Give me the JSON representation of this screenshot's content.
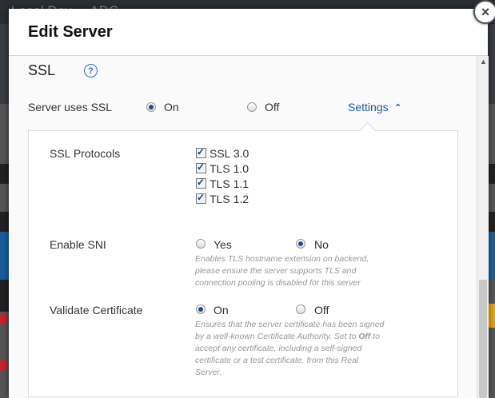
{
  "background": {
    "title": "Local Dev ... ADC"
  },
  "dialog": {
    "title": "Edit Server",
    "close_label": "×"
  },
  "ssl": {
    "section_title": "SSL",
    "help_label": "?",
    "server_uses_ssl": {
      "label": "Server uses SSL",
      "options": [
        {
          "label": "On",
          "checked": true
        },
        {
          "label": "Off",
          "checked": false
        }
      ]
    },
    "settings_link": "Settings",
    "settings_chevron": "⌃",
    "protocols": {
      "label": "SSL Protocols",
      "items": [
        {
          "label": "SSL 3.0",
          "checked": true
        },
        {
          "label": "TLS 1.0",
          "checked": true
        },
        {
          "label": "TLS 1.1",
          "checked": true
        },
        {
          "label": "TLS 1.2",
          "checked": true
        }
      ]
    },
    "sni": {
      "label": "Enable SNI",
      "options": [
        {
          "label": "Yes",
          "checked": false
        },
        {
          "label": "No",
          "checked": true
        }
      ],
      "help": [
        "Enables TLS hostname extension on backend,",
        "please ensure the server supports TLS and",
        "connection pooling is disabled for this server"
      ]
    },
    "validate": {
      "label": "Validate Certificate",
      "options": [
        {
          "label": "On",
          "checked": true
        },
        {
          "label": "Off",
          "checked": false
        }
      ],
      "help_pre": "Ensures that the server certificate has been signed by a well-known Certificate Authority. Set to ",
      "help_bold": "Off",
      "help_post": " to accept any certificate, including a self-signed certificate or a test certificate, from this Real Server."
    }
  },
  "colors": {
    "accent": "#1f5aa0",
    "radio_dot": "#1f4f8a"
  }
}
